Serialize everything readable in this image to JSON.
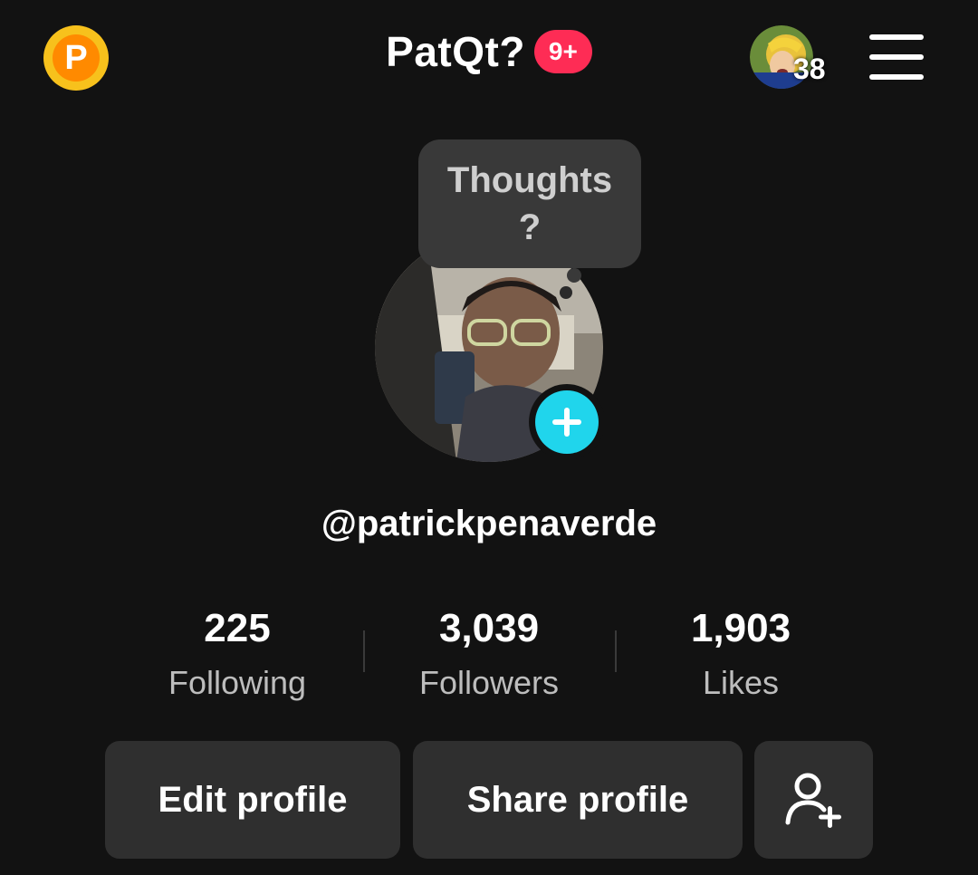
{
  "header": {
    "coin_letter": "P",
    "title": "PatQt?",
    "notification_badge": "9+",
    "friend_count": "38"
  },
  "profile": {
    "thought_line1": "Thoughts",
    "thought_line2": "?",
    "username": "@patrickpenaverde"
  },
  "stats": [
    {
      "value": "225",
      "label": "Following"
    },
    {
      "value": "3,039",
      "label": "Followers"
    },
    {
      "value": "1,903",
      "label": "Likes"
    }
  ],
  "actions": {
    "edit_label": "Edit profile",
    "share_label": "Share profile"
  },
  "colors": {
    "accent_badge": "#fe2c55",
    "plus_button": "#20d5ec",
    "coin": "#f7c11c",
    "background": "#121212",
    "button_bg": "#2f2f2f"
  },
  "icons": [
    "coin-icon",
    "menu-icon",
    "plus-icon",
    "add-friend-icon"
  ]
}
